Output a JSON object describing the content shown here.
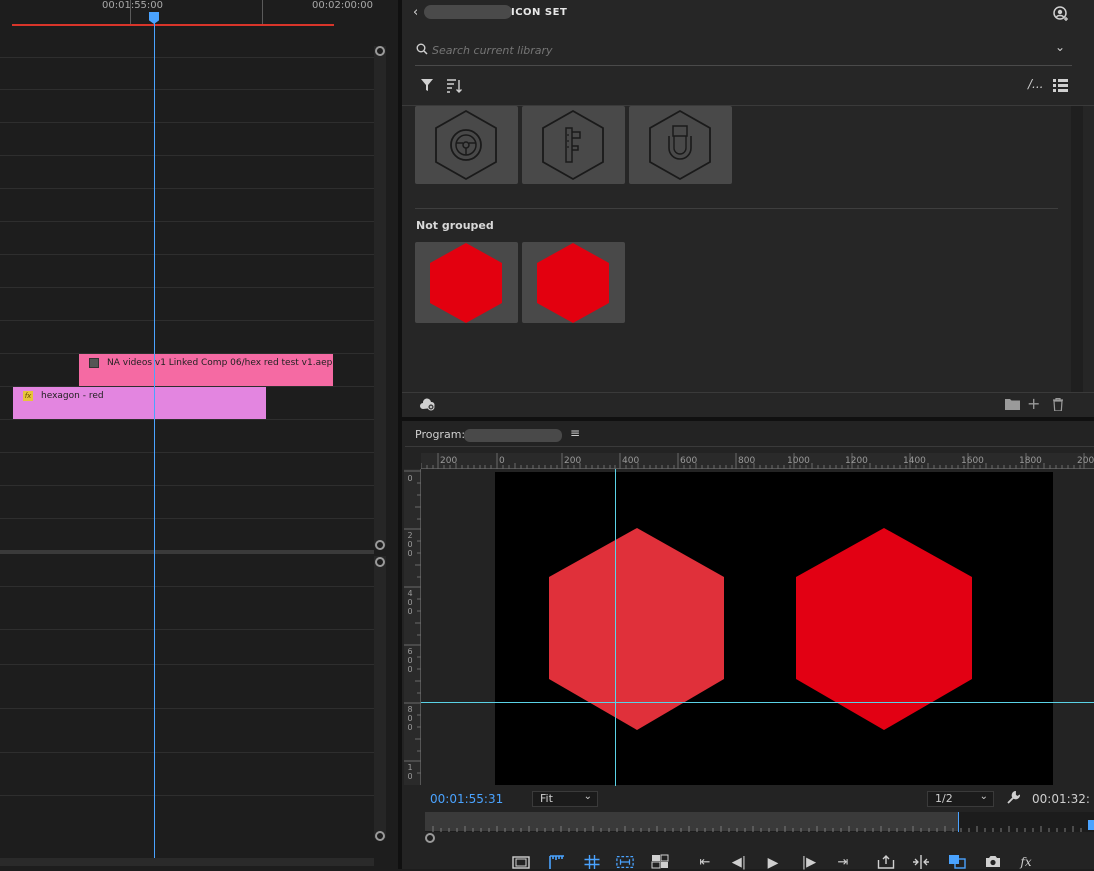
{
  "timeline": {
    "ruler_times": [
      "00:01:55:00",
      "00:02:00:00"
    ],
    "clips": [
      {
        "label": "NA videos v1 Linked Comp 06/hex red test v1.aep",
        "color": "#f56aa3"
      },
      {
        "label": "hexagon - red",
        "color": "#e385e0",
        "icon": "fx"
      }
    ],
    "playhead_color": "#4aa3ff"
  },
  "libraries": {
    "title": "ICON SET",
    "search_placeholder": "Search current library",
    "grouped_icons": [
      "steering-wheel-hexagon-icon",
      "caliper-hexagon-icon",
      "clamp-hexagon-icon"
    ],
    "group_label": "Not grouped",
    "ungrouped_icons": [
      "red-hexagon",
      "red-hexagon"
    ],
    "accent_red": "#e3000f"
  },
  "program": {
    "title": "Program:",
    "ruler_labels": [
      "200",
      "0",
      "200",
      "400",
      "600",
      "800",
      "1000",
      "1200",
      "1400",
      "1600",
      "1800",
      "200"
    ],
    "vruler_labels": [
      "0",
      "2\n0\n0",
      "4\n0\n0",
      "6\n0\n0",
      "8\n0\n0",
      "1\n0"
    ],
    "current_timecode": "00:01:55:31",
    "zoom": "Fit",
    "resolution": "1/2",
    "duration_timecode": "00:01:32:",
    "hexagon_colors": [
      "#e0303a",
      "#e20013"
    ]
  }
}
